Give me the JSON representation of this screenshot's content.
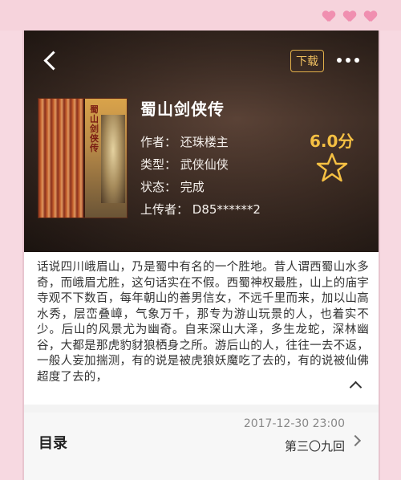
{
  "header": {
    "download_label": "下载"
  },
  "book": {
    "title": "蜀山剑侠传",
    "cover_title": "蜀山剑侠传",
    "author_line": "作者：  还珠楼主",
    "type_line": "类型：  武侠仙侠",
    "status_line": "状态：  完成",
    "uploader_line": "上传者：  D85******2",
    "score": "6.0分"
  },
  "summary": "话说四川峨眉山，乃是蜀中有名的一个胜地。昔人谓西蜀山水多奇，而峨眉尤胜，这句话实在不假。西蜀神权最胜，山上的庙宇寺观不下数百，每年朝山的善男信女，不远千里而来，加以山高水秀，层峦叠嶂，气象万千，那专为游山玩景的人，也着实不少。后山的风景尤为幽奇。自来深山大泽，多生龙蛇，深林幽谷，大都是那虎豹豺狼栖身之所。游后山的人，往往一去不返，一般人妄加揣测，有的说是被虎狼妖魔吃了去的，有的说被仙佛超度了去的，",
  "toc": {
    "label": "目录",
    "updated": "2017-12-30 23:00",
    "latest_chapter": "第三〇九回"
  },
  "colors": {
    "accent": "#f5c043",
    "frame": "#f6d3dc"
  }
}
